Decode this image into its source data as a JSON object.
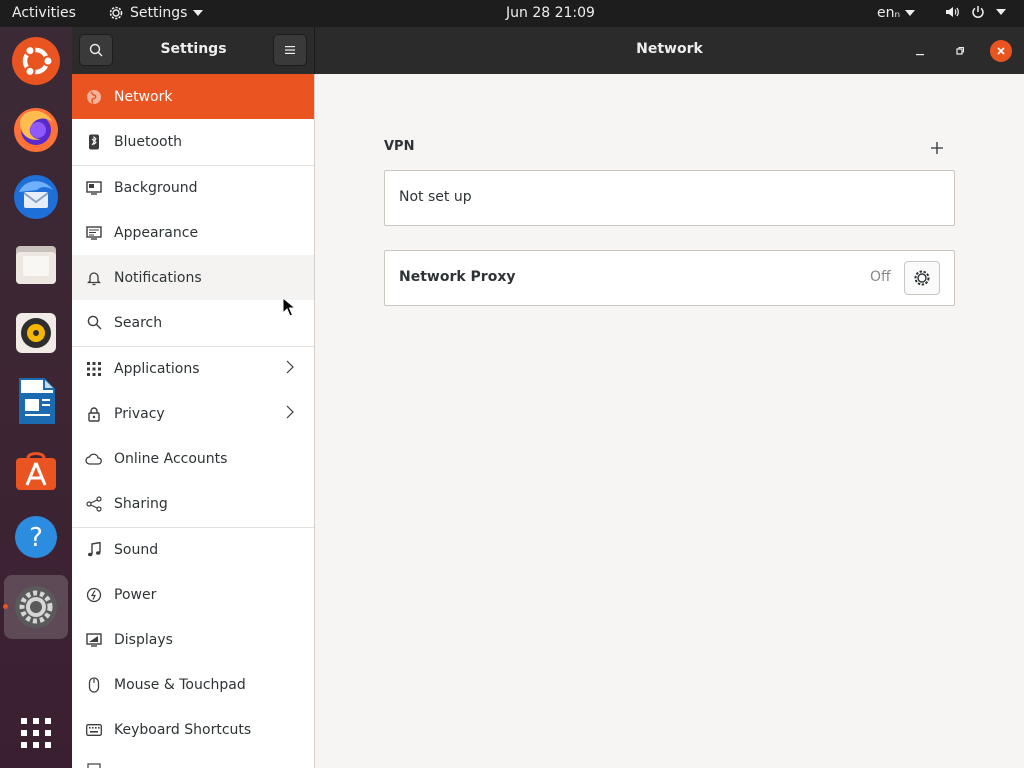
{
  "topbar": {
    "activities": "Activities",
    "app_menu": "Settings",
    "clock": "Jun 28  21:09",
    "lang": "enₙ"
  },
  "dock": {
    "items": [
      {
        "name": "ubuntu-icon"
      },
      {
        "name": "firefox-icon"
      },
      {
        "name": "thunderbird-icon"
      },
      {
        "name": "files-icon"
      },
      {
        "name": "rhythmbox-icon"
      },
      {
        "name": "libreoffice-writer-icon"
      },
      {
        "name": "software-icon"
      },
      {
        "name": "help-icon"
      },
      {
        "name": "settings-icon"
      },
      {
        "name": "show-apps-icon"
      }
    ]
  },
  "window": {
    "sidebar_title": "Settings",
    "main_title": "Network"
  },
  "sidebar": {
    "items": [
      {
        "label": "Network",
        "icon": "globe-icon"
      },
      {
        "label": "Bluetooth",
        "icon": "bluetooth-icon"
      },
      {
        "label": "Background",
        "icon": "background-icon"
      },
      {
        "label": "Appearance",
        "icon": "appearance-icon"
      },
      {
        "label": "Notifications",
        "icon": "bell-icon"
      },
      {
        "label": "Search",
        "icon": "search-icon"
      },
      {
        "label": "Applications",
        "icon": "grid-icon"
      },
      {
        "label": "Privacy",
        "icon": "lock-icon"
      },
      {
        "label": "Online Accounts",
        "icon": "cloud-icon"
      },
      {
        "label": "Sharing",
        "icon": "share-icon"
      },
      {
        "label": "Sound",
        "icon": "music-note-icon"
      },
      {
        "label": "Power",
        "icon": "power-icon"
      },
      {
        "label": "Displays",
        "icon": "display-icon"
      },
      {
        "label": "Mouse & Touchpad",
        "icon": "mouse-icon"
      },
      {
        "label": "Keyboard Shortcuts",
        "icon": "keyboard-icon"
      }
    ]
  },
  "main": {
    "vpn_title": "VPN",
    "vpn_status": "Not set up",
    "proxy_label": "Network Proxy",
    "proxy_status": "Off"
  },
  "colors": {
    "accent": "#e95420",
    "header_bg": "#2b2b2b",
    "topbar_bg": "#1d1d1d"
  }
}
